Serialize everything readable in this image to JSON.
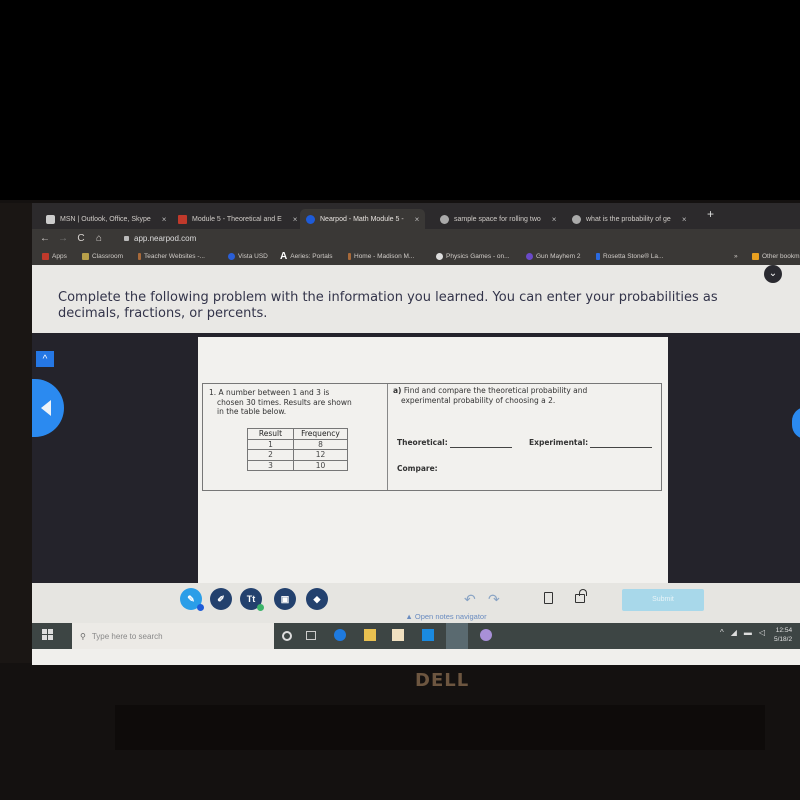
{
  "browser": {
    "tabs": [
      {
        "title": "MSN | Outlook, Office, Skype",
        "icon": "msn-icon",
        "color": "#cccccc"
      },
      {
        "title": "Module 5 - Theoretical and E",
        "icon": "classroom-icon",
        "color": "#c0392b"
      },
      {
        "title": "Nearpod - Math Module 5 -",
        "icon": "nearpod-icon",
        "color": "#1e5bd8",
        "active": true
      },
      {
        "title": "sample space for rolling two",
        "icon": "google-icon",
        "color": "#aaaaaa"
      },
      {
        "title": "what is the probability of ge",
        "icon": "google-icon",
        "color": "#aaaaaa"
      }
    ],
    "new_tab": "+",
    "close_glyph": "×",
    "url": "app.nearpod.com",
    "nav": {
      "back": "←",
      "forward": "→",
      "reload": "C",
      "home": "⌂"
    },
    "bookmarks": [
      {
        "label": "Apps",
        "icon": "apps-icon",
        "color": "#c0392b"
      },
      {
        "label": "Classroom",
        "icon": "classroom-icon",
        "color": "#b8a04a"
      },
      {
        "label": "Teacher Websites -...",
        "icon": "bookmark-icon",
        "color": "#a86a3a"
      },
      {
        "label": "Vista USD",
        "icon": "vista-icon",
        "color": "#2a5fd8"
      },
      {
        "label": "Aeries: Portals",
        "icon": "aeries-icon",
        "color": "#ffffff"
      },
      {
        "label": "Home - Madison M...",
        "icon": "bookmark-icon",
        "color": "#a86a3a"
      },
      {
        "label": "Physics Games - on...",
        "icon": "physics-icon",
        "color": "#dddddd"
      },
      {
        "label": "Gun Mayhem 2",
        "icon": "game-icon",
        "color": "#6a4ac8"
      },
      {
        "label": "Rosetta Stone® La...",
        "icon": "rosetta-icon",
        "color": "#2a6ae0"
      }
    ],
    "more_bookmarks": "»",
    "other_bookmarks": "Other bookmarks"
  },
  "nearpod": {
    "instructions": "Complete the following problem with the information you learned.  You can enter your probabilities as decimals, fractions, or percents.",
    "collapse_glyph": "⌄",
    "up_glyph": "^",
    "problem": {
      "number": "1.",
      "text_line1": "A number between 1 and 3 is",
      "text_line2": "chosen 30 times. Results are shown",
      "text_line3": "in the table below.",
      "table": {
        "headers": [
          "Result",
          "Frequency"
        ],
        "rows": [
          [
            "1",
            "8"
          ],
          [
            "2",
            "12"
          ],
          [
            "3",
            "10"
          ]
        ]
      },
      "question_label": "a)",
      "question_line1": "Find and compare the theoretical probability and",
      "question_line2": "experimental probability of choosing a 2.",
      "theoretical_label": "Theoretical:",
      "experimental_label": "Experimental:",
      "compare_label": "Compare:"
    },
    "tools": {
      "pen": "pencil-icon",
      "highlighter": "highlighter-icon",
      "text": "Tt",
      "image": "image-icon",
      "eraser": "eraser-icon",
      "undo": "↶",
      "redo": "↷",
      "submit": "Submit"
    },
    "notes_navigator": "▲  Open notes navigator"
  },
  "taskbar": {
    "search_placeholder": "Type here to search",
    "tray_up": "^",
    "time": "12:54",
    "date": "5/18/2"
  },
  "laptop_brand": "DELL"
}
